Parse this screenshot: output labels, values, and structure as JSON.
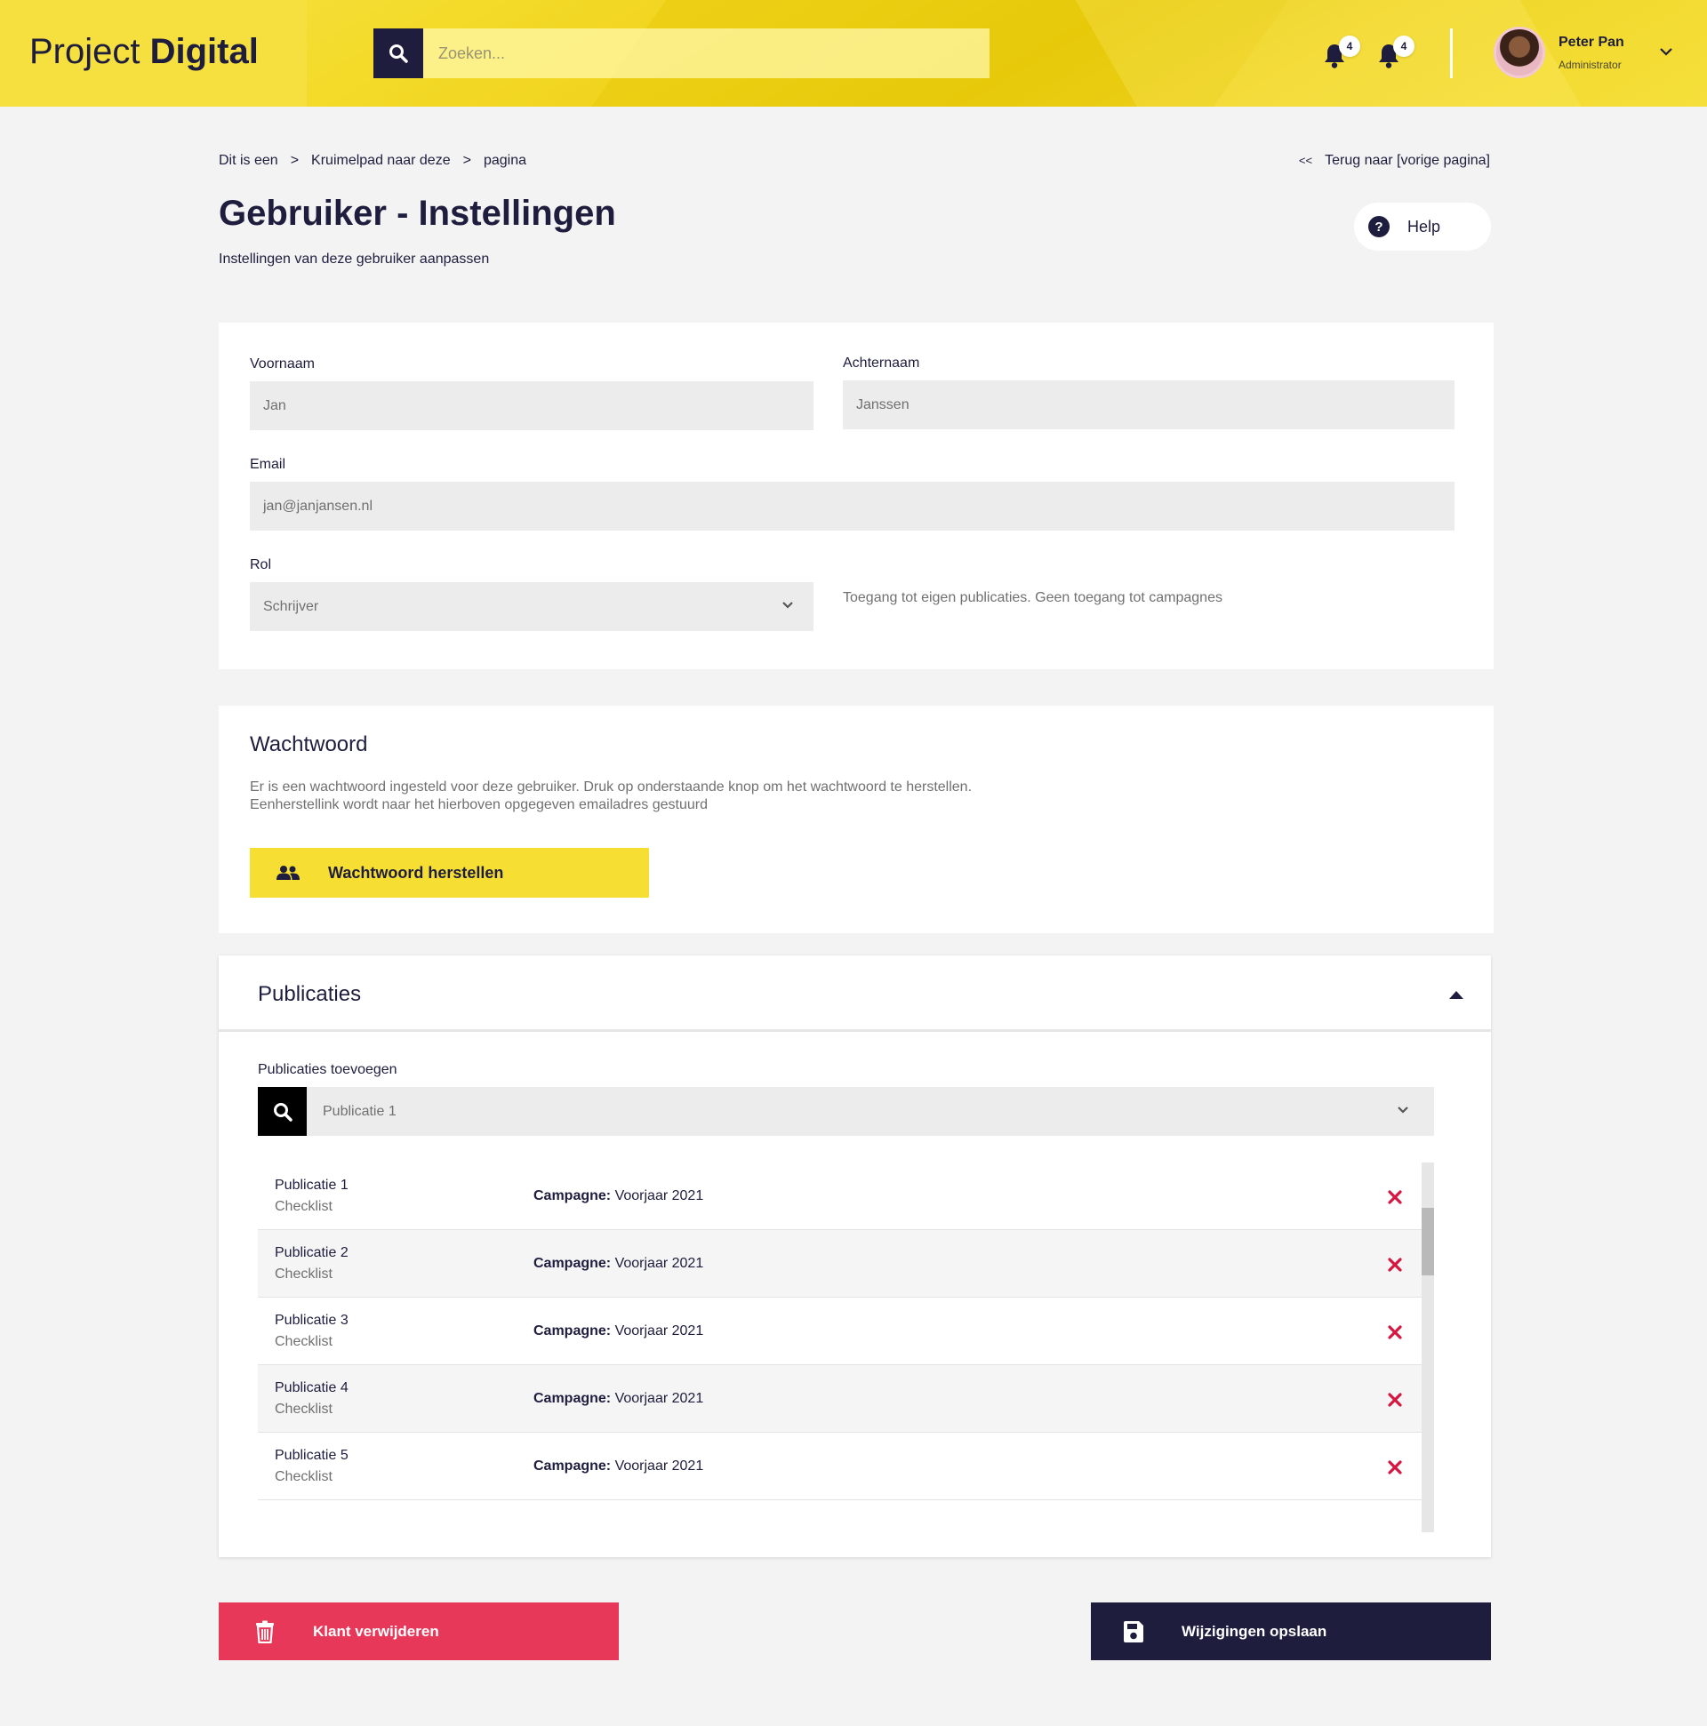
{
  "header": {
    "logo_light": "Project",
    "logo_bold": "Digital",
    "search_placeholder": "Zoeken...",
    "notifications": [
      {
        "icon": "bell-icon",
        "count": "4"
      },
      {
        "icon": "bell-icon",
        "count": "4"
      }
    ],
    "user": {
      "name": "Peter Pan",
      "role": "Administrator"
    }
  },
  "breadcrumb": {
    "items": [
      "Dit is een",
      "Kruimelpad naar deze",
      "pagina"
    ],
    "separator": ">"
  },
  "back_link": {
    "arrows": "<<",
    "label": "Terug naar [vorige pagina]"
  },
  "page": {
    "title": "Gebruiker - Instellingen",
    "subtitle": "Instellingen van deze gebruiker aanpassen",
    "help_label": "Help",
    "help_icon_glyph": "?"
  },
  "form": {
    "first_name_label": "Voornaam",
    "first_name_value": "Jan",
    "last_name_label": "Achternaam",
    "last_name_value": "Janssen",
    "email_label": "Email",
    "email_value": "jan@janjansen.nl",
    "role_label": "Rol",
    "role_value": "Schrijver",
    "role_hint": "Toegang tot eigen publicaties. Geen toegang tot campagnes"
  },
  "password": {
    "title": "Wachtwoord",
    "description_line1": "Er is een wachtwoord ingesteld voor deze gebruiker. Druk op onderstaande knop om het wachtwoord te herstellen.",
    "description_line2": "Eenherstellink wordt naar het hierboven opgegeven emailadres gestuurd",
    "reset_label": "Wachtwoord herstellen"
  },
  "publications": {
    "title": "Publicaties",
    "add_label": "Publicaties toevoegen",
    "select_value": "Publicatie 1",
    "campaign_prefix": "Campagne:",
    "scroll_position": 0.15,
    "items": [
      {
        "name": "Publicatie 1",
        "type": "Checklist",
        "campaign": "Voorjaar 2021"
      },
      {
        "name": "Publicatie 2",
        "type": "Checklist",
        "campaign": "Voorjaar 2021"
      },
      {
        "name": "Publicatie 3",
        "type": "Checklist",
        "campaign": "Voorjaar 2021"
      },
      {
        "name": "Publicatie 4",
        "type": "Checklist",
        "campaign": "Voorjaar 2021"
      },
      {
        "name": "Publicatie 5",
        "type": "Checklist",
        "campaign": "Voorjaar 2021"
      }
    ]
  },
  "actions": {
    "delete_label": "Klant verwijderen",
    "save_label": "Wijzigingen opslaan"
  },
  "colors": {
    "brand_yellow": "#f6df32",
    "navy": "#1e1d3e",
    "danger": "#e8385a",
    "delete_x": "#d6163f"
  }
}
